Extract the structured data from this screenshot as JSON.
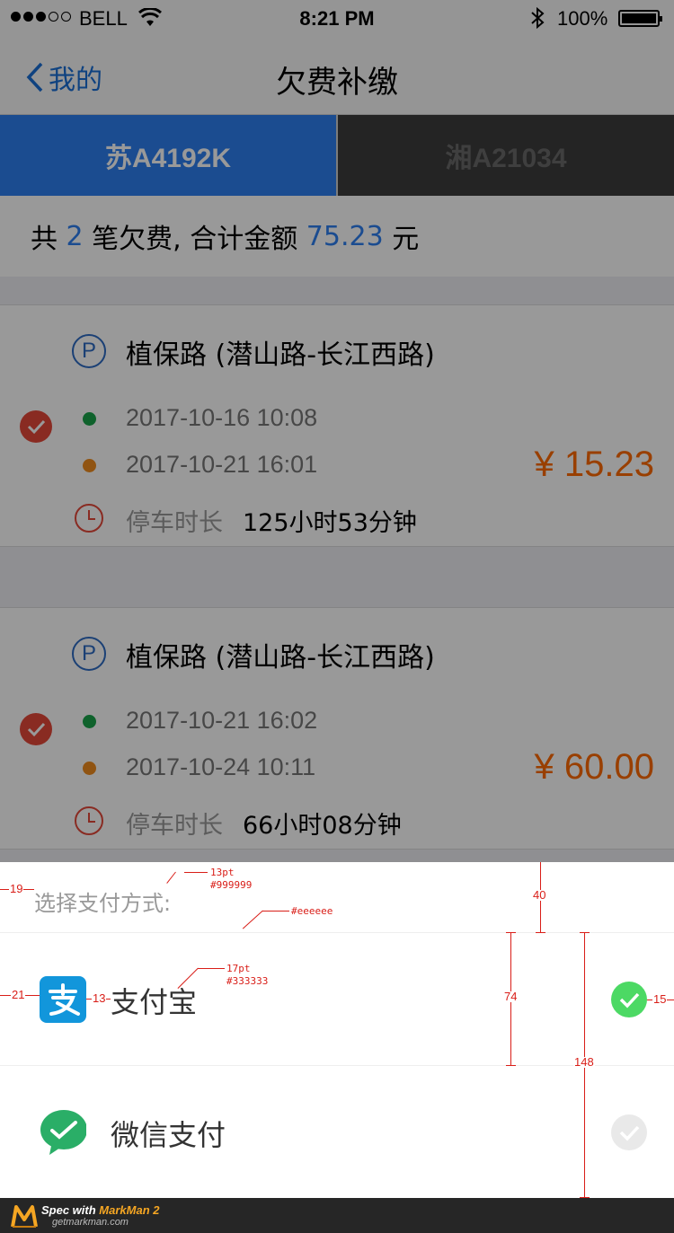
{
  "status_bar": {
    "signal_dots": 5,
    "signal_filled": 3,
    "carrier": "BELL",
    "time": "8:21 PM",
    "battery": "100%"
  },
  "nav": {
    "back_label": "我的",
    "title": "欠费补缴"
  },
  "plates": [
    {
      "label": "苏A4192K",
      "active": true
    },
    {
      "label": "湘A21034",
      "active": false
    }
  ],
  "summary": {
    "prefix": "共 ",
    "count": "2",
    "middle": " 笔欠费, 合计金额 ",
    "total": "75.23",
    "suffix": " 元"
  },
  "bills": [
    {
      "road": "植保路 (潜山路-长江西路)",
      "entry_time": "2017-10-16 10:08",
      "exit_time": "2017-10-21 16:01",
      "duration_label": "停车时长",
      "duration": "125小时53分钟",
      "amount": "¥ 15.23",
      "selected": true
    },
    {
      "road": "植保路 (潜山路-长江西路)",
      "entry_time": "2017-10-21 16:02",
      "exit_time": "2017-10-24 10:11",
      "duration_label": "停车时长",
      "duration": "66小时08分钟",
      "amount": "¥ 60.00",
      "selected": true
    }
  ],
  "payment_sheet": {
    "title": "选择支付方式:",
    "options": [
      {
        "label": "支付宝",
        "icon": "alipay-icon",
        "selected": true
      },
      {
        "label": "微信支付",
        "icon": "wechat-icon",
        "selected": false
      }
    ]
  },
  "spec_annotations": {
    "title_font": "13pt",
    "title_color": "#999999",
    "divider_color": "#eeeeee",
    "label_font": "17pt",
    "label_color": "#333333",
    "left_margin_title": "19",
    "left_margin_icon": "21",
    "icon_gap": "13",
    "title_height": "40",
    "row_height": "74",
    "rows_total_height": "148",
    "radio_right": "15"
  },
  "footer": {
    "spec_prefix": "Spec with ",
    "brand": "MarkMan 2",
    "url": "getmarkman.com"
  },
  "colors": {
    "accent_blue": "#2d7ff0",
    "amount_orange": "#ff6a00",
    "check_red": "#e5483a",
    "radio_green": "#4cd964",
    "alipay_blue": "#1296db",
    "wechat_green": "#2aae67"
  }
}
